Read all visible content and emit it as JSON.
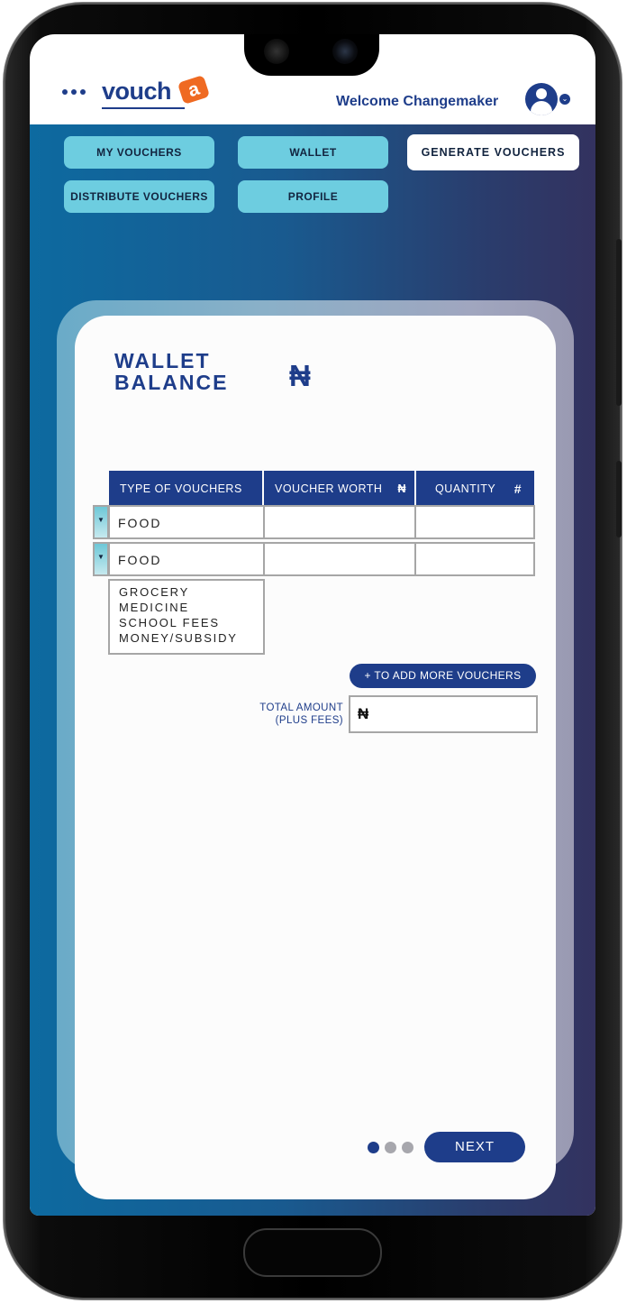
{
  "header": {
    "logo_text": "vouch",
    "logo_tag": "a",
    "welcome": "Welcome Changemaker",
    "menu_icon": "more-dots-icon",
    "avatar_icon": "user-avatar-icon",
    "caret_glyph": "⌄"
  },
  "nav": {
    "my_vouchers": "MY VOUCHERS",
    "wallet": "WALLET",
    "generate_vouchers": "GENERATE VOUCHERS",
    "distribute_vouchers": "DISTRIBUTE VOUCHERS",
    "profile": "PROFILE"
  },
  "card": {
    "wallet_balance_line1": "WALLET",
    "wallet_balance_line2": "BALANCE",
    "currency": "₦"
  },
  "table": {
    "headers": {
      "type": "TYPE OF VOUCHERS",
      "worth": "VOUCHER WORTH",
      "worth_symbol": "₦",
      "quantity": "QUANTITY",
      "quantity_symbol": "#"
    },
    "rows": [
      {
        "type": "FOOD",
        "worth": "",
        "quantity": ""
      },
      {
        "type": "FOOD",
        "worth": "",
        "quantity": ""
      }
    ],
    "dropdown_glyph": "▼",
    "options": [
      "GROCERY",
      "MEDICINE",
      "SCHOOL FEES",
      "MONEY/SUBSIDY"
    ]
  },
  "actions": {
    "add_more": "+ TO ADD MORE  VOUCHERS",
    "total_label_line1": "TOTAL AMOUNT",
    "total_label_line2": "(PLUS FEES)",
    "total_value": "₦",
    "next": "NEXT"
  },
  "pager": {
    "pages": 3,
    "current": 1
  },
  "colors": {
    "brand_blue": "#1e3d8a",
    "nav_button": "#6dcde0",
    "logo_accent": "#ef6a22"
  }
}
